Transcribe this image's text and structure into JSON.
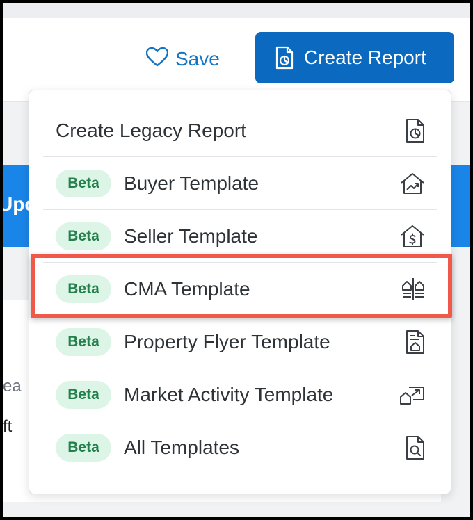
{
  "header": {
    "save_label": "Save",
    "create_report_label": "Create Report"
  },
  "background": {
    "strip_text": "Upc",
    "text_line_1": "ea",
    "text_line_2": "ft"
  },
  "dropdown": {
    "legacy_item": {
      "label": "Create Legacy Report",
      "icon": "report-chart-icon"
    },
    "items": [
      {
        "badge": "Beta",
        "label": "Buyer Template",
        "icon": "house-trend-icon"
      },
      {
        "badge": "Beta",
        "label": "Seller Template",
        "icon": "house-dollar-icon"
      },
      {
        "badge": "Beta",
        "label": "CMA Template",
        "icon": "compare-houses-icon"
      },
      {
        "badge": "Beta",
        "label": "Property Flyer Template",
        "icon": "flyer-house-icon"
      },
      {
        "badge": "Beta",
        "label": "Market Activity Template",
        "icon": "market-activity-icon"
      },
      {
        "badge": "Beta",
        "label": "All Templates",
        "icon": "search-document-icon"
      }
    ]
  },
  "colors": {
    "primary_blue": "#0b6ac0",
    "link_blue": "#1474c4",
    "badge_bg": "#ddf5e7",
    "badge_text": "#23804b",
    "highlight_red": "#f0584a"
  }
}
